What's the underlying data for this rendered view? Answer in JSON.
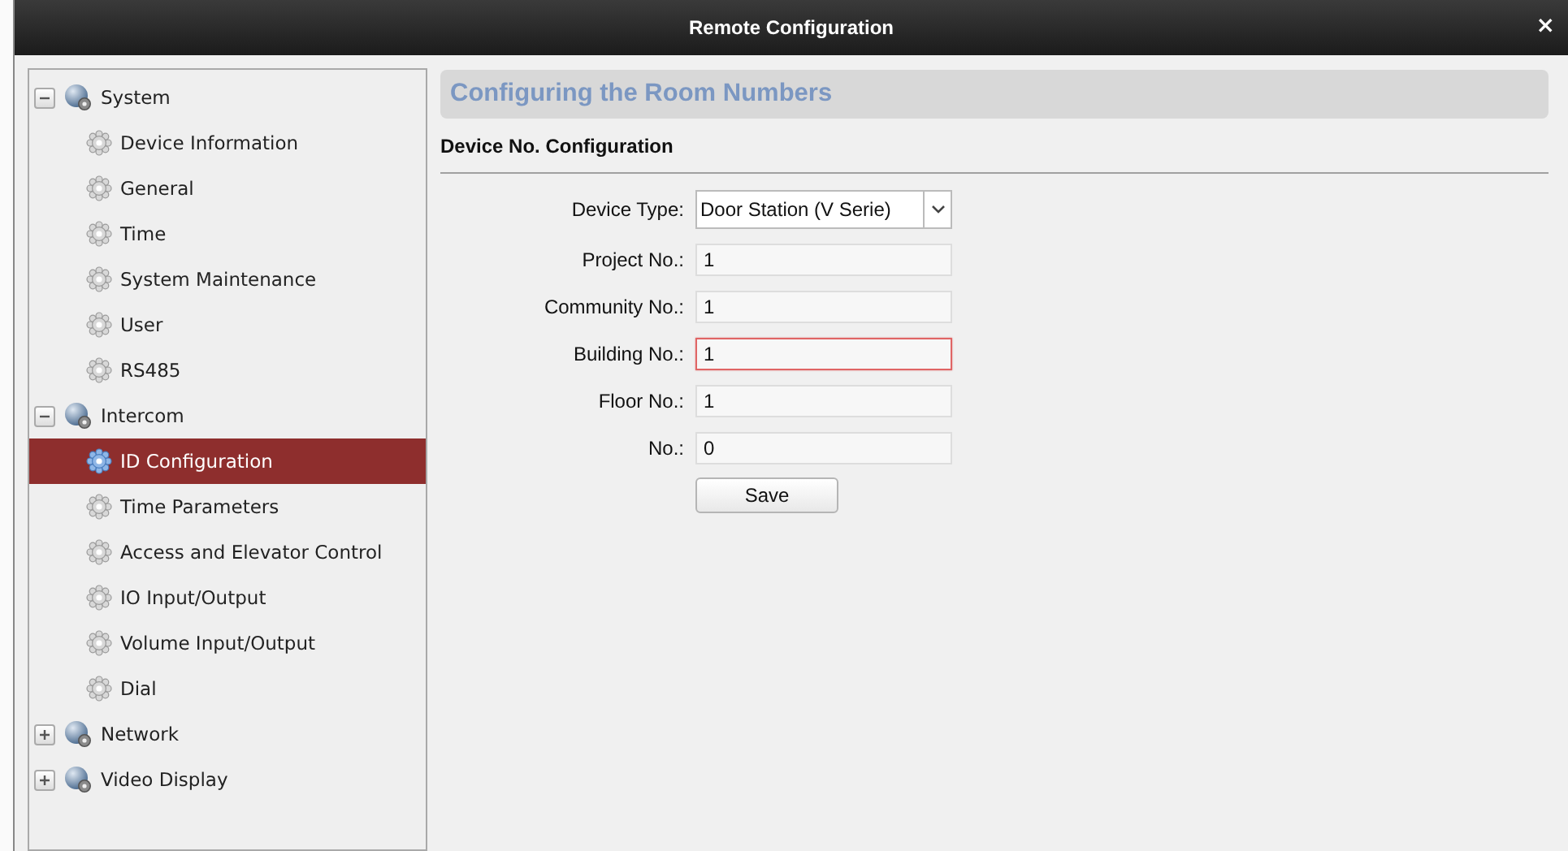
{
  "window": {
    "title": "Remote Configuration",
    "close": "×"
  },
  "sidebar": {
    "items": [
      {
        "label": "System",
        "expanded": true,
        "selected": false,
        "children": [
          {
            "label": "Device Information",
            "selected": false
          },
          {
            "label": "General",
            "selected": false
          },
          {
            "label": "Time",
            "selected": false
          },
          {
            "label": "System Maintenance",
            "selected": false
          },
          {
            "label": "User",
            "selected": false
          },
          {
            "label": "RS485",
            "selected": false
          }
        ]
      },
      {
        "label": "Intercom",
        "expanded": true,
        "selected": false,
        "children": [
          {
            "label": "ID Configuration",
            "selected": true
          },
          {
            "label": "Time Parameters",
            "selected": false
          },
          {
            "label": "Access and Elevator Control",
            "selected": false
          },
          {
            "label": "IO Input/Output",
            "selected": false
          },
          {
            "label": "Volume Input/Output",
            "selected": false
          },
          {
            "label": "Dial",
            "selected": false
          }
        ]
      },
      {
        "label": "Network",
        "expanded": false,
        "selected": false
      },
      {
        "label": "Video Display",
        "expanded": false,
        "selected": false
      }
    ]
  },
  "panel": {
    "header": "Configuring the Room Numbers",
    "section_title": "Device No. Configuration",
    "fields": [
      {
        "kind": "select",
        "label": "Device Type:",
        "value": "Door Station (V Serie)",
        "focused": false
      },
      {
        "kind": "text",
        "label": "Project No.:",
        "value": "1",
        "focused": false
      },
      {
        "kind": "text",
        "label": "Community No.:",
        "value": "1",
        "focused": false
      },
      {
        "kind": "text",
        "label": "Building No.:",
        "value": "1",
        "focused": true
      },
      {
        "kind": "text",
        "label": "Floor No.:",
        "value": "1",
        "focused": false
      },
      {
        "kind": "text",
        "label": "No.:",
        "value": "0",
        "focused": false
      }
    ],
    "save_button": "Save"
  }
}
